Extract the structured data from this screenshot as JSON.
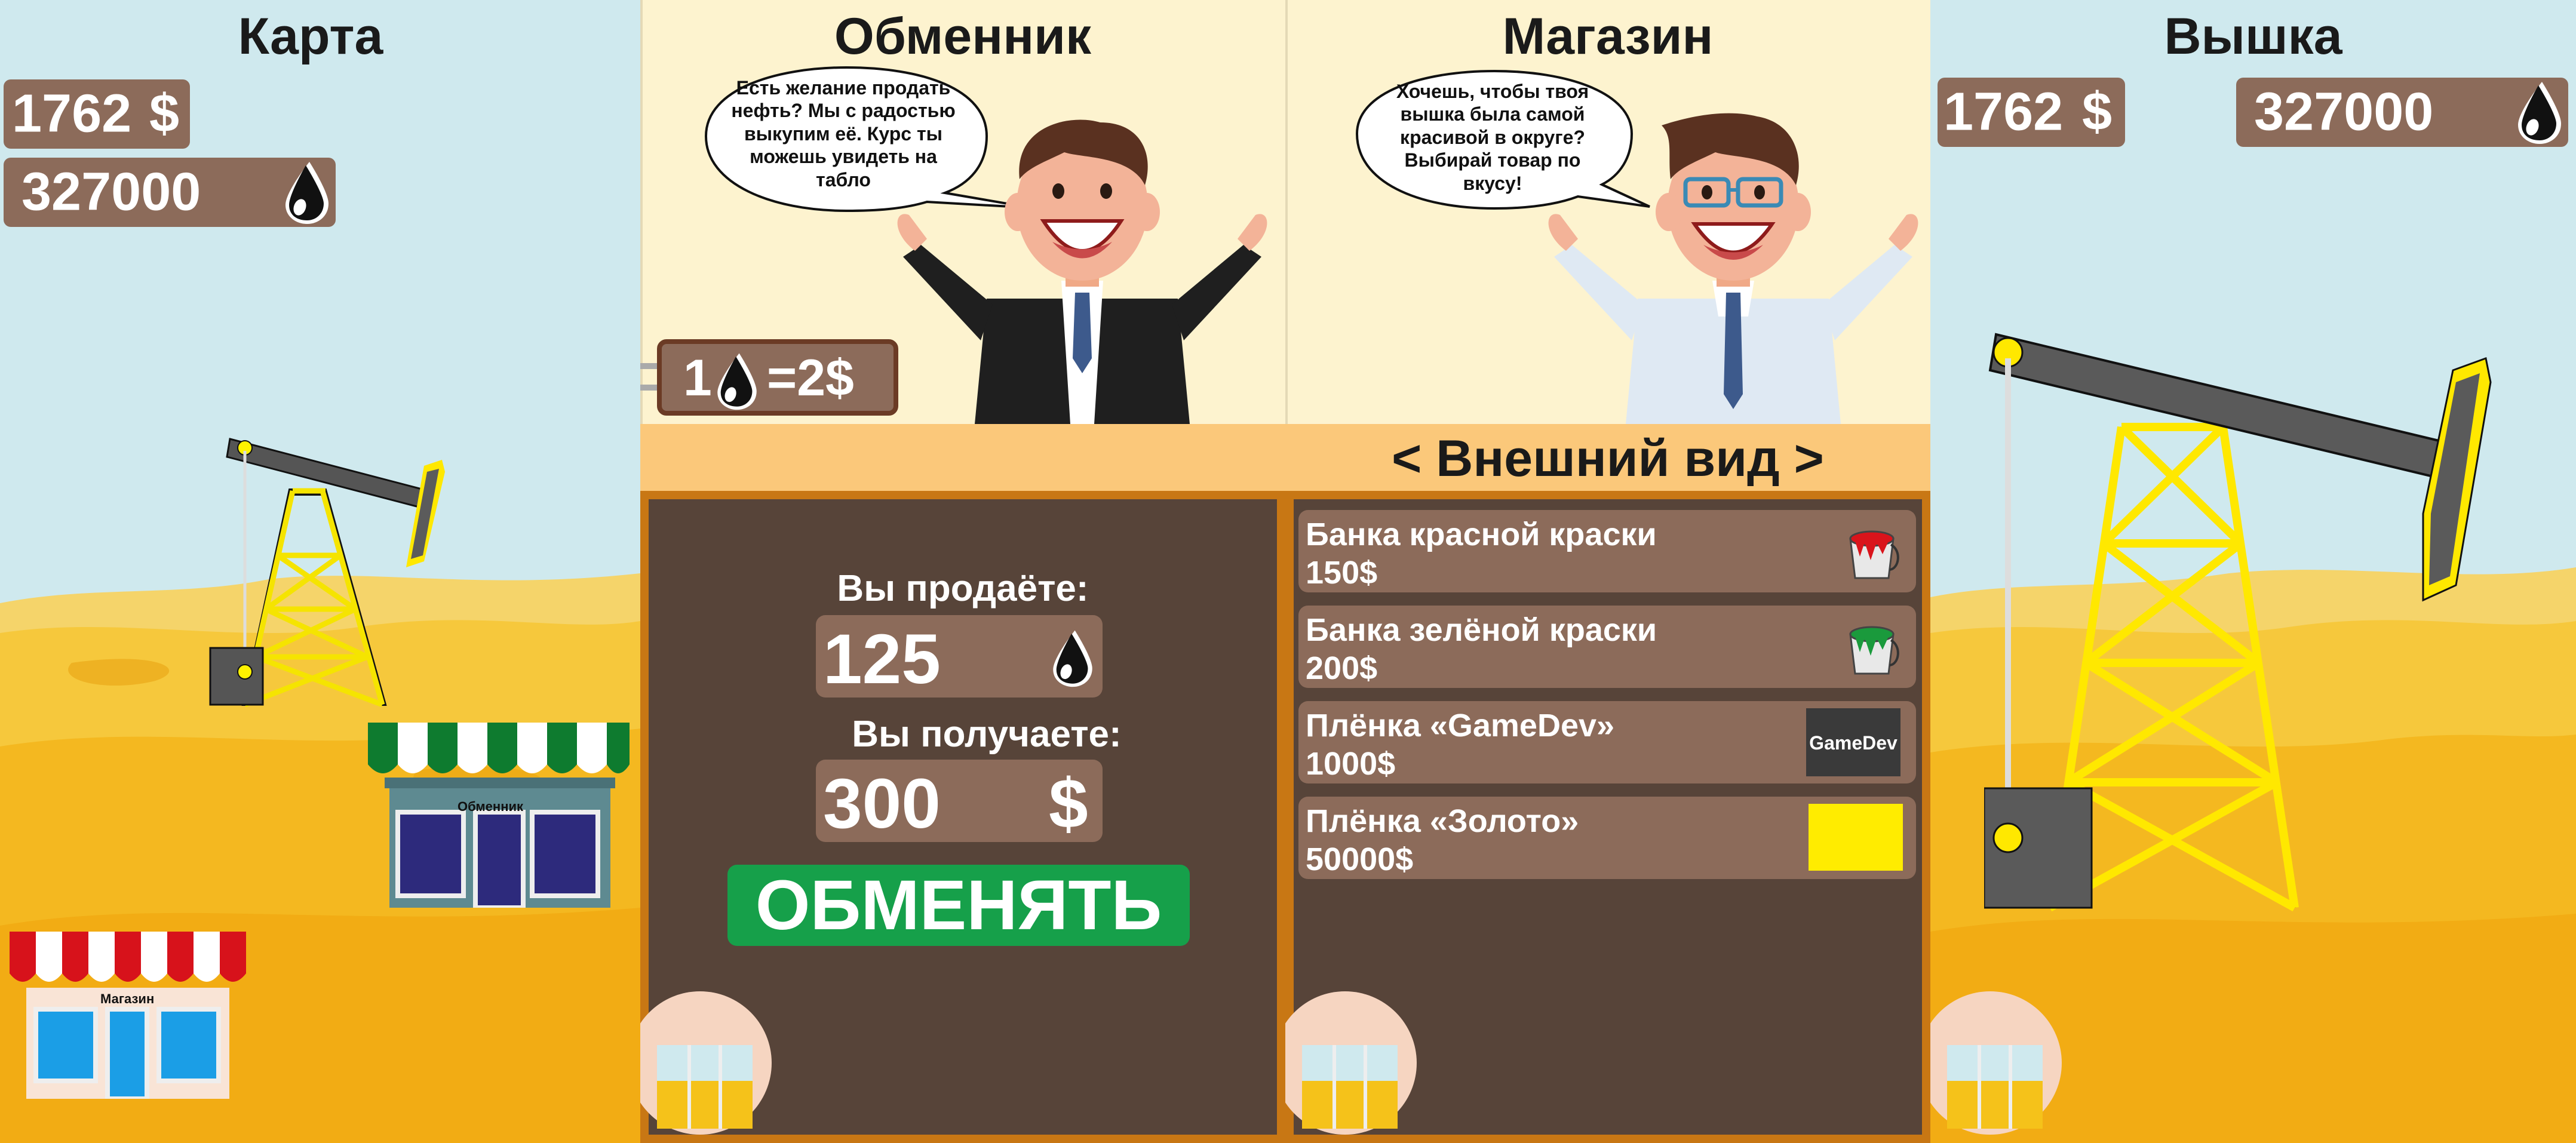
{
  "map": {
    "title": "Карта",
    "money": "1762",
    "money_symbol": "$",
    "oil": "327000",
    "shop_sign": "Магазин",
    "exchanger_sign": "Обменник"
  },
  "exchanger": {
    "title": "Обменник",
    "speech": "Есть желание продать нефть? Мы с радостью выкупим её. Курс ты можешь увидеть на табло",
    "rate_left": "1",
    "rate_right": "=2$",
    "sell_label": "Вы продаёте:",
    "sell_value": "125",
    "get_label": "Вы получаете:",
    "get_value": "300",
    "get_symbol": "$",
    "exchange_button": "ОБМЕНЯТЬ"
  },
  "shop": {
    "title": "Магазин",
    "speech": "Хочешь, чтобы твоя вышка была самой красивой в округе? Выбирай товар по вкусу!",
    "category": "< Внешний вид >",
    "items": [
      {
        "name": "Банка красной краски",
        "price": "150$",
        "icon": "red-paint-bucket-icon",
        "color": "#d9141b"
      },
      {
        "name": "Банка зелёной краски",
        "price": "200$",
        "icon": "green-paint-bucket-icon",
        "color": "#1a9a3c"
      },
      {
        "name": "Плёнка «GameDev»",
        "price": "1000$",
        "icon": "gamedev-film-icon",
        "label": "GameDev"
      },
      {
        "name": "Плёнка «Золото»",
        "price": "50000$",
        "icon": "gold-film-icon",
        "color": "#ffec00"
      }
    ]
  },
  "tower": {
    "title": "Вышка",
    "money": "1762",
    "money_symbol": "$",
    "oil": "327000"
  },
  "colors": {
    "sky": "#cfe9ee",
    "sand": "#f5c21a",
    "board": "#574439",
    "board_border": "#c87714",
    "box": "#8c6b5a",
    "button": "#16a04a",
    "cream": "#fdf3cf"
  }
}
